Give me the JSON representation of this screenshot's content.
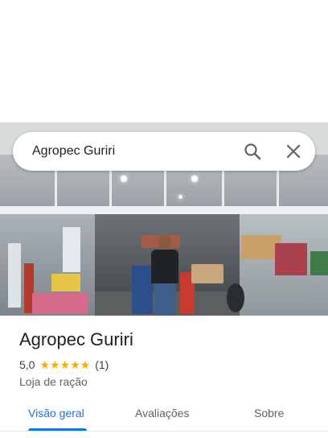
{
  "search": {
    "query": "Agropec Guriri"
  },
  "place": {
    "name": "Agropec Guriri",
    "rating": "5,0",
    "stars": "★★★★★",
    "review_count": "(1)",
    "category": "Loja de ração"
  },
  "tabs": [
    {
      "label": "Visão geral",
      "active": true
    },
    {
      "label": "Avaliações",
      "active": false
    },
    {
      "label": "Sobre",
      "active": false
    }
  ],
  "colors": {
    "accent": "#1a73e8",
    "star": "#f9ab00",
    "text": "#202124"
  },
  "icons": [
    "search-icon",
    "close-icon"
  ]
}
